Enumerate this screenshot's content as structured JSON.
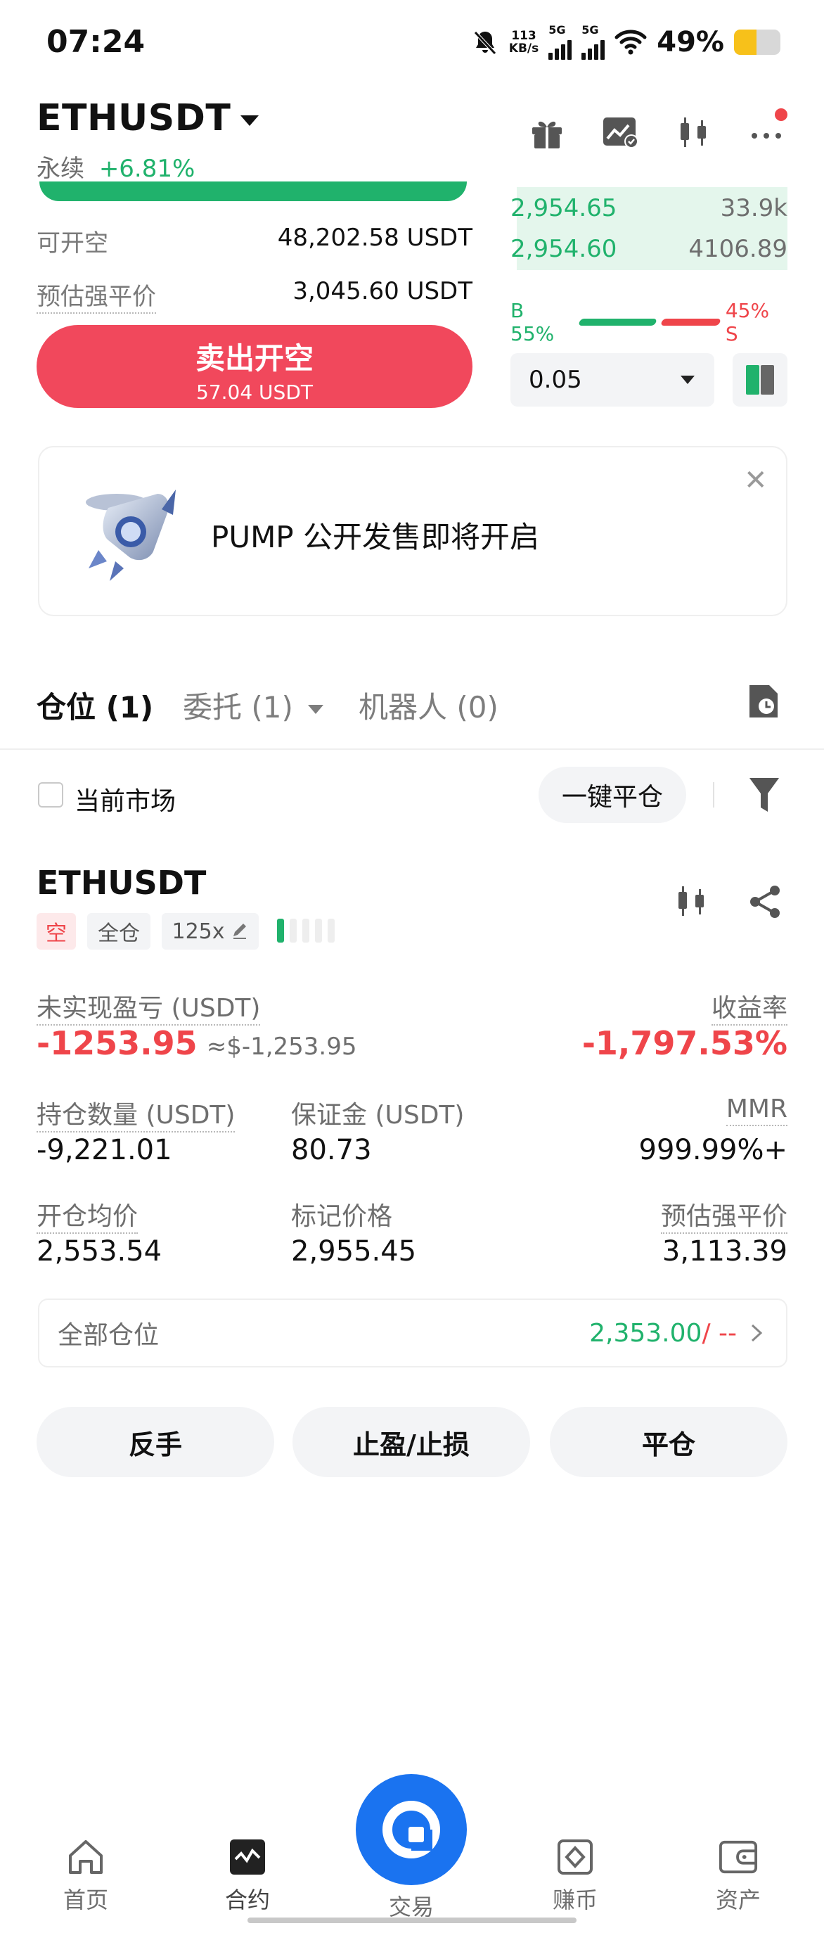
{
  "status_bar": {
    "time": "07:24",
    "net_speed": "113",
    "net_unit": "KB/s",
    "sig1": "5G",
    "sig2": "5G",
    "battery": "49%"
  },
  "header": {
    "symbol": "ETHUSDT",
    "type": "永续",
    "change": "+6.81%"
  },
  "order_panel": {
    "short_available_label": "可开空",
    "short_available_value": "48,202.58 USDT",
    "est_liq_label": "预估强平价",
    "est_liq_value": "3,045.60 USDT",
    "sell_button_label": "卖出开空",
    "sell_button_amount": "57.04 USDT"
  },
  "order_book": {
    "rows": [
      {
        "price": "2,954.65",
        "size": "33.9k"
      },
      {
        "price": "2,954.60",
        "size": "4106.89"
      }
    ],
    "buy_ratio": "B 55%",
    "sell_ratio": "45% S",
    "precision": "0.05"
  },
  "promo": {
    "text": "PUMP 公开发售即将开启",
    "close": "✕"
  },
  "tabs": [
    {
      "label": "仓位 (1)"
    },
    {
      "label": "委托 (1)"
    },
    {
      "label": "机器人 (0)"
    }
  ],
  "filter": {
    "current_market_label": "当前市场",
    "close_all_label": "一键平仓"
  },
  "position": {
    "symbol": "ETHUSDT",
    "side_tag": "空",
    "margin_mode_tag": "全仓",
    "leverage_tag": "125x",
    "unrealized_pnl_label": "未实现盈亏 (USDT)",
    "unrealized_pnl_value": "-1253.95",
    "unrealized_pnl_approx": "≈$-1,253.95",
    "roe_label": "收益率",
    "roe_value": "-1,797.53%",
    "size_label": "持仓数量 (USDT)",
    "size_value": "-9,221.01",
    "margin_label": "保证金 (USDT)",
    "margin_value": "80.73",
    "mmr_label": "MMR",
    "mmr_value": "999.99%+",
    "entry_label": "开仓均价",
    "entry_value": "2,553.54",
    "mark_label": "标记价格",
    "mark_value": "2,955.45",
    "liq_label": "预估强平价",
    "liq_value": "3,113.39",
    "risk_level": 0.2
  },
  "all_positions": {
    "label": "全部仓位",
    "value": "2,353.00",
    "suffix": " / --"
  },
  "actions": {
    "reverse": "反手",
    "tpsl": "止盈/止损",
    "close": "平仓"
  },
  "nav": {
    "home": "首页",
    "futures": "合约",
    "trade": "交易",
    "earn": "赚币",
    "assets": "资产"
  },
  "colors": {
    "green": "#20b26c",
    "red": "#ef454a",
    "orange": "#f0a045",
    "brand_blue": "#1a73f0"
  }
}
